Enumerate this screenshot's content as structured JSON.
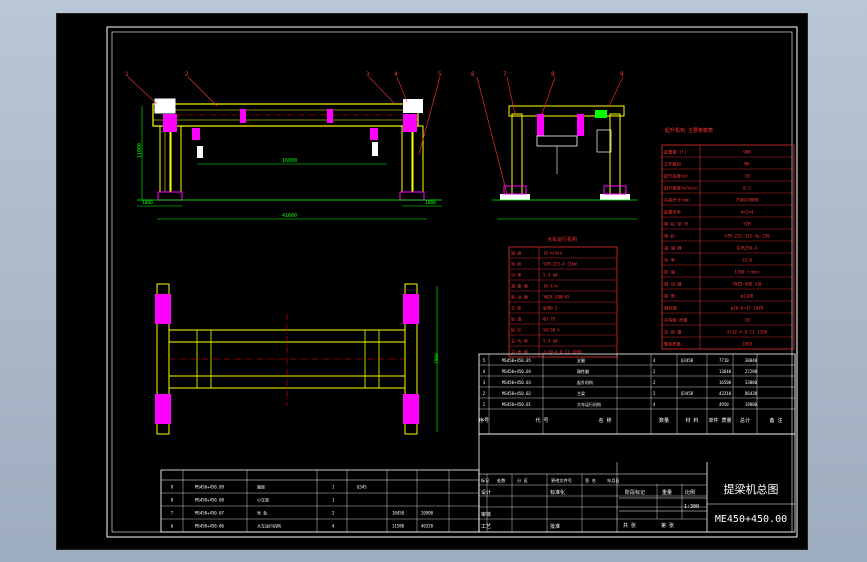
{
  "colors": {
    "background": "#000000",
    "border": "#ffffff",
    "structure": "#ffff00",
    "accent": "#ff0000",
    "dimension": "#00ff00",
    "detail": "#ff00ff",
    "leader": "#ff3333"
  },
  "elevation_callouts": [
    "1",
    "2",
    "3",
    "4",
    "5"
  ],
  "side_callouts": [
    "6",
    "7",
    "8",
    "9"
  ],
  "dimensions": {
    "front_span": "16000",
    "front_total": "41600",
    "front_height": "11000",
    "front_left": "1000",
    "front_right": "1000",
    "plan_height": "7800"
  },
  "params_table": {
    "title": "起升机构 主要参数表",
    "rows": [
      {
        "label": "起重量 (t)",
        "value": "900"
      },
      {
        "label": "工作级别",
        "value": "M6"
      },
      {
        "label": "起升高度(m)",
        "value": "10"
      },
      {
        "label": "起升速度(m/min)",
        "value": "0.5"
      },
      {
        "label": "吊具尺寸(mm)",
        "value": "7500×8000"
      },
      {
        "label": "起重倍率",
        "value": "m=2×4"
      },
      {
        "label": "电 机 型 号",
        "value": "YZR"
      },
      {
        "label": "电 机",
        "value": "YZR-225-315-4p-250"
      },
      {
        "label": "减 速 器",
        "value": "QJR250-A"
      },
      {
        "label": "功 率",
        "value": "25.6"
      },
      {
        "label": "转 速",
        "value": "1200 r/min"
      },
      {
        "label": "制 动 器",
        "value": "YWZ5-400 2台"
      },
      {
        "label": "卷 筒",
        "value": "φ1100"
      },
      {
        "label": "钢丝绳",
        "value": "φ20-6×37-1670"
      },
      {
        "label": "吊钩组 质量",
        "value": "10"
      },
      {
        "label": "总 质 量",
        "value": "2×12-4.8 11 1350"
      },
      {
        "label": "整机质量",
        "value": "1850"
      }
    ]
  },
  "travel_table": {
    "title": "大车运行机构",
    "rows": [
      {
        "label": "速 度",
        "value": "10 m/min"
      },
      {
        "label": "电 机",
        "value": "YZR-225-4 11kW"
      },
      {
        "label": "功 率",
        "value": "5.5 kW"
      },
      {
        "label": "减 速 器",
        "value": "10 t/m"
      },
      {
        "label": "制 动 器",
        "value": "YWZ4-300/45"
      },
      {
        "label": "车 轮",
        "value": "φ500 2"
      },
      {
        "label": "轨 道",
        "value": "QU 70"
      },
      {
        "label": "轮 压",
        "value": "50/30 t"
      },
      {
        "label": "总 功 率",
        "value": "5.5 kW"
      },
      {
        "label": "总 质 量",
        "value": "2×10-4.8 11 1050"
      }
    ]
  },
  "bom_upper": {
    "rows": [
      [
        "5",
        "MS450+450.05",
        "支腿",
        "4",
        "Q345B",
        "7710",
        "30840"
      ],
      [
        "4",
        "MS450+450.04",
        "刚性腿",
        "2",
        "",
        "13640",
        "27280"
      ],
      [
        "3",
        "MS450+450.03",
        "起升机构",
        "2",
        "",
        "16500",
        "33000"
      ],
      [
        "2",
        "MS450+450.02",
        "主梁",
        "2",
        "Q345B",
        "43210",
        "86420"
      ],
      [
        "1",
        "MS450+450.01",
        "大车运行机构",
        "4",
        "",
        "4950",
        "19800"
      ]
    ],
    "header": [
      "序号",
      "代 号",
      "名 称",
      "数量",
      "材 料",
      "单件 质量",
      "总计",
      "备 注"
    ]
  },
  "bom_lower": {
    "rows": [
      [
        "9",
        "MS450+450.09",
        "端梁",
        "1",
        "Q345",
        "",
        ""
      ],
      [
        "8",
        "MS450+450.08",
        "小车架",
        "1",
        "",
        "",
        ""
      ],
      [
        "7",
        "MS450+450.07",
        "导 轨",
        "2",
        "",
        "10450",
        "20900"
      ],
      [
        "6",
        "MS450+450.06",
        "大车运行机构",
        "4",
        "",
        "11580",
        "46320"
      ]
    ]
  },
  "title_block": {
    "labels": [
      "标记",
      "处数",
      "分 区",
      "更改文件号",
      "签 名",
      "年月日"
    ],
    "design": "设计",
    "standard": "标准化",
    "review": "审核",
    "process": "工艺",
    "approve": "批准",
    "stage": "阶段标记",
    "weight": "重量",
    "scale": "比例",
    "scale_value": "1:300",
    "sheets": "共  张",
    "sheet": "第  张",
    "drawing_title": "提梁机总图",
    "drawing_number": "ME450+450.00"
  }
}
